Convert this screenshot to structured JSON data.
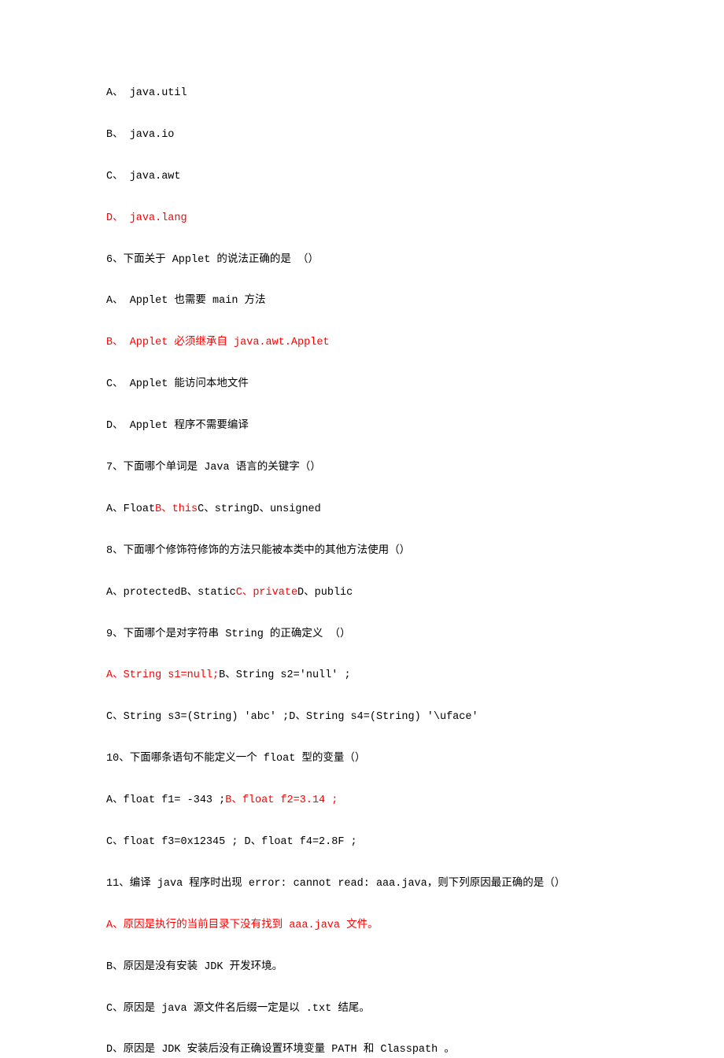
{
  "lines": [
    {
      "parts": [
        {
          "t": "A、  java.util"
        }
      ]
    },
    {
      "parts": [
        {
          "t": "B、  java.io"
        }
      ]
    },
    {
      "parts": [
        {
          "t": "C、  java.awt"
        }
      ]
    },
    {
      "parts": [
        {
          "t": "D、  java.lang",
          "red": true
        }
      ]
    },
    {
      "parts": [
        {
          "t": "6、下面关于 Applet 的说法正确的是  （）"
        }
      ]
    },
    {
      "parts": [
        {
          "t": "A、  Applet 也需要 main 方法"
        }
      ]
    },
    {
      "parts": [
        {
          "t": "B、  Applet 必须继承自 java.awt.Applet",
          "red": true
        }
      ]
    },
    {
      "parts": [
        {
          "t": "C、  Applet 能访问本地文件"
        }
      ]
    },
    {
      "parts": [
        {
          "t": "D、  Applet 程序不需要编译"
        }
      ]
    },
    {
      "parts": [
        {
          "t": "7、下面哪个单词是 Java 语言的关键字（）"
        }
      ]
    },
    {
      "parts": [
        {
          "t": "A、Float"
        },
        {
          "t": "B、this",
          "red": true
        },
        {
          "t": "C、string"
        },
        {
          "t": "D、unsigned"
        }
      ]
    },
    {
      "parts": [
        {
          "t": "8、下面哪个修饰符修饰的方法只能被本类中的其他方法使用（）"
        }
      ]
    },
    {
      "parts": [
        {
          "t": "A、protected"
        },
        {
          "t": "B、static"
        },
        {
          "t": "C、private",
          "red": true
        },
        {
          "t": "D、public"
        }
      ]
    },
    {
      "parts": [
        {
          "t": "9、下面哪个是对字符串 String 的正确定义  （）"
        }
      ]
    },
    {
      "parts": [
        {
          "t": "A、String s1=null;",
          "red": true
        },
        {
          "t": "B、String s2='null'  ;"
        }
      ]
    },
    {
      "parts": [
        {
          "t": "C、String s3=(String)  'abc'  ;"
        },
        {
          "t": "D、String s4=(String)  '\\uface'"
        }
      ]
    },
    {
      "parts": [
        {
          "t": "10、下面哪条语句不能定义一个 float 型的变量（）"
        }
      ]
    },
    {
      "parts": [
        {
          "t": "A、float f1= -343 ;"
        },
        {
          "t": "B、float f2=3.14 ;",
          "red": true
        }
      ]
    },
    {
      "parts": [
        {
          "t": "C、float f3=0x12345 ; "
        },
        {
          "t": "D、float f4=2.8F ;"
        }
      ]
    },
    {
      "parts": [
        {
          "t": "11、编译 java 程序时出现 error: cannot read: aaa.java，则下列原因最正确的是（）"
        }
      ]
    },
    {
      "parts": [
        {
          "t": "A、原因是执行的当前目录下没有找到 aaa.java 文件。",
          "red": true
        }
      ]
    },
    {
      "parts": [
        {
          "t": "B、原因是没有安装 JDK 开发环境。"
        }
      ]
    },
    {
      "parts": [
        {
          "t": "C、原因是 java 源文件名后缀一定是以 .txt 结尾。"
        }
      ]
    },
    {
      "parts": [
        {
          "t": "D、原因是 JDK 安装后没有正确设置环境变量 PATH 和 Classpath 。"
        }
      ]
    }
  ]
}
